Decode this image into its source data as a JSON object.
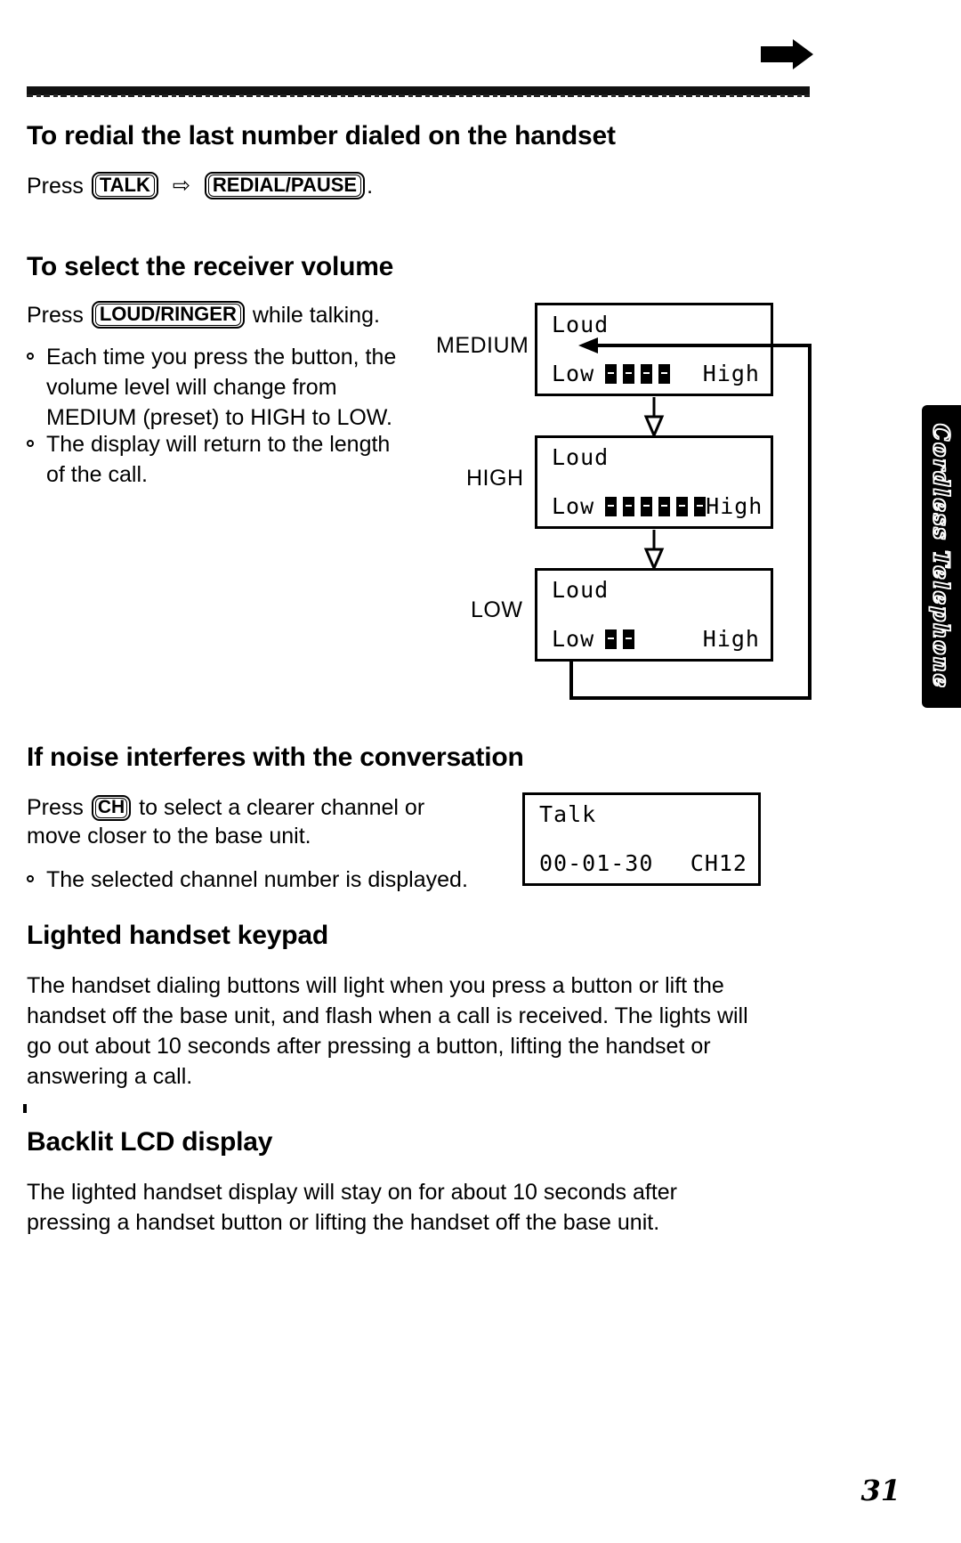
{
  "document": {
    "page_number": "31",
    "side_tab_label": "Cordless Telephone",
    "top_marker_icon": "right-arrow-icon"
  },
  "sections": [
    {
      "id": "redial",
      "title": "To redial the last number dialed on the handset",
      "instruction_prefix": "Press",
      "keys": [
        "TALK",
        "REDIAL/PAUSE"
      ],
      "arrow_glyph": "⇨",
      "instruction_suffix": "."
    },
    {
      "id": "receiver-volume",
      "title": "To select the receiver volume",
      "instruction_prefix": "Press",
      "key": "LOUD/RINGER",
      "instruction_suffix": "while talking.",
      "bullets": [
        "Each time you press the button, the volume level will change from MEDIUM (preset) to HIGH to LOW.",
        "The display will return to the length of the call."
      ],
      "bullet_lines": [
        [
          "Each time you press the button, the",
          "volume level will change from",
          "MEDIUM (preset) to HIGH to LOW."
        ],
        [
          "The display will return to the length",
          "of the call."
        ]
      ],
      "steps": [
        {
          "label": "MEDIUM",
          "display": {
            "top": "Loud",
            "left": "Low",
            "right": "High",
            "bars": 4
          }
        },
        {
          "label": "HIGH",
          "display": {
            "top": "Loud",
            "left": "Low",
            "right": "High",
            "bars": 6
          }
        },
        {
          "label": "LOW",
          "display": {
            "top": "Loud",
            "left": "Low",
            "right": "High",
            "bars": 2
          }
        }
      ]
    },
    {
      "id": "noise",
      "title": "If noise interferes with the conversation",
      "instruction_prefix": "Press",
      "key": "CH",
      "instruction_lines": [
        "to select a clearer channel or",
        "move closer to the base unit."
      ],
      "bullet": "The selected channel number is displayed.",
      "display": {
        "top": "Talk",
        "bottom_left": "00-01-30",
        "bottom_right": "CH12"
      }
    },
    {
      "id": "lighted-keypad",
      "title": "Lighted handset keypad",
      "paragraph_lines": [
        "The handset dialing buttons will light when you press a button or lift the",
        "handset off the base unit, and flash when a call is received. The lights will",
        "go out about 10 seconds after pressing a button, lifting the handset or",
        "answering a call."
      ]
    },
    {
      "id": "backlit-lcd",
      "title": "Backlit LCD display",
      "paragraph_lines": [
        "The lighted handset display will stay on for about 10 seconds after",
        "pressing a handset button or lifting the handset off the base unit."
      ]
    }
  ]
}
